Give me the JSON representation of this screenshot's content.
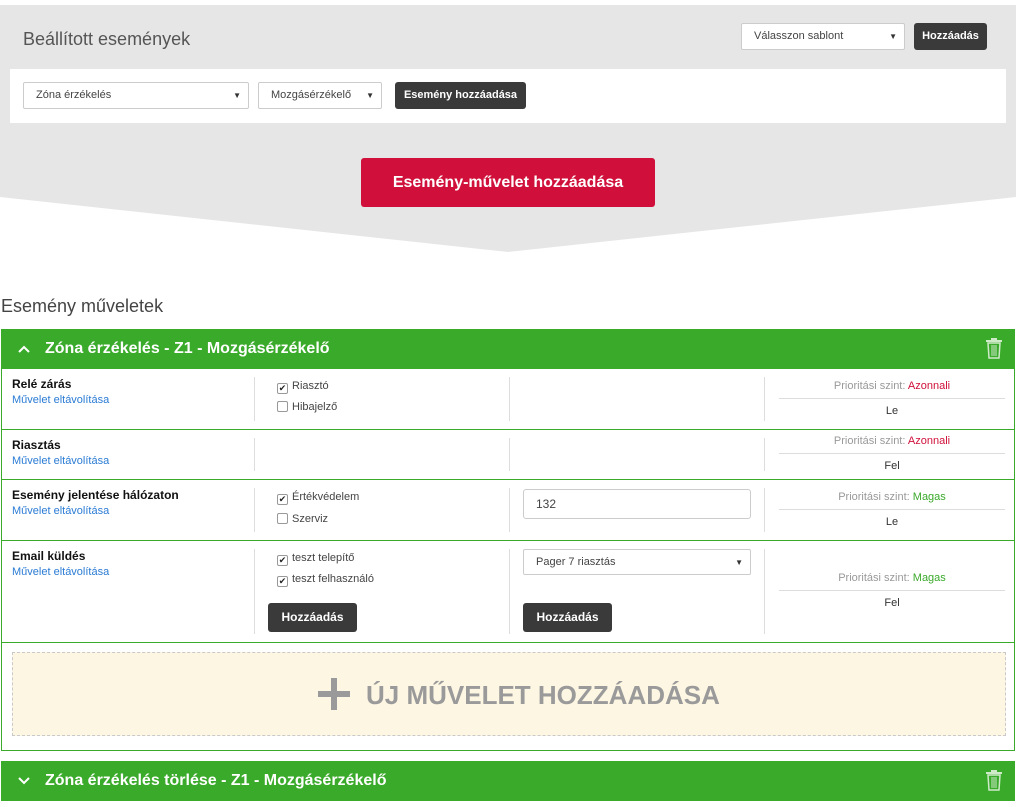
{
  "header": {
    "title": "Beállított események",
    "template_select": "Válasszon sablont",
    "add_label": "Hozzáadás"
  },
  "filters": {
    "zone_select": "Zóna érzékelés",
    "sensor_select": "Mozgásérzékelő",
    "add_event_label": "Esemény hozzáadása"
  },
  "add_event_action_label": "Esemény-művelet hozzáadása",
  "section_title": "Esemény műveletek",
  "groups": [
    {
      "title": "Zóna érzékelés - Z1 - Mozgásérzékelő",
      "expanded": true,
      "actions": [
        {
          "title": "Relé zárás",
          "remove": "Művelet eltávolítása",
          "checkboxes": [
            {
              "label": "Riasztó",
              "checked": true
            },
            {
              "label": "Hibajelző",
              "checked": false
            }
          ],
          "priority_label": "Prioritási szint:",
          "priority_value": "Azonnali",
          "direction": "Le"
        },
        {
          "title": "Riasztás",
          "remove": "Művelet eltávolítása",
          "priority_label": "Prioritási szint:",
          "priority_value": "Azonnali",
          "direction": "Fel"
        },
        {
          "title": "Esemény jelentése hálózaton",
          "remove": "Művelet eltávolítása",
          "checkboxes": [
            {
              "label": "Értékvédelem",
              "checked": true
            },
            {
              "label": "Szerviz",
              "checked": false
            }
          ],
          "input_value": "132",
          "priority_label": "Prioritási szint:",
          "priority_value": "Magas",
          "direction": "Le"
        },
        {
          "title": "Email küldés",
          "remove": "Művelet eltávolítása",
          "checkboxes": [
            {
              "label": "teszt telepítő",
              "checked": true
            },
            {
              "label": "teszt felhasználó",
              "checked": true
            }
          ],
          "select_value": "Pager 7 riasztás",
          "add_label_1": "Hozzáadás",
          "add_label_2": "Hozzáadás",
          "priority_label": "Prioritási szint:",
          "priority_value": "Magas",
          "direction": "Fel"
        }
      ],
      "new_action_label": "ÚJ MŰVELET HOZZÁADÁSA"
    },
    {
      "title": "Zóna érzékelés törlése - Z1 - Mozgásérzékelő",
      "expanded": false
    }
  ],
  "colors": {
    "accent_green": "#3aaa2a",
    "accent_red": "#d0103a",
    "link_blue": "#2a7bd4",
    "button_dark": "#3a3a3a"
  },
  "icons": {
    "expanded_chevron": "chevron-up-icon",
    "collapsed_chevron": "chevron-down-icon",
    "delete": "trash-icon",
    "add": "plus-icon",
    "dropdown": "caret-down-icon",
    "checked": "checkbox-checked-icon",
    "unchecked": "checkbox-empty-icon"
  }
}
